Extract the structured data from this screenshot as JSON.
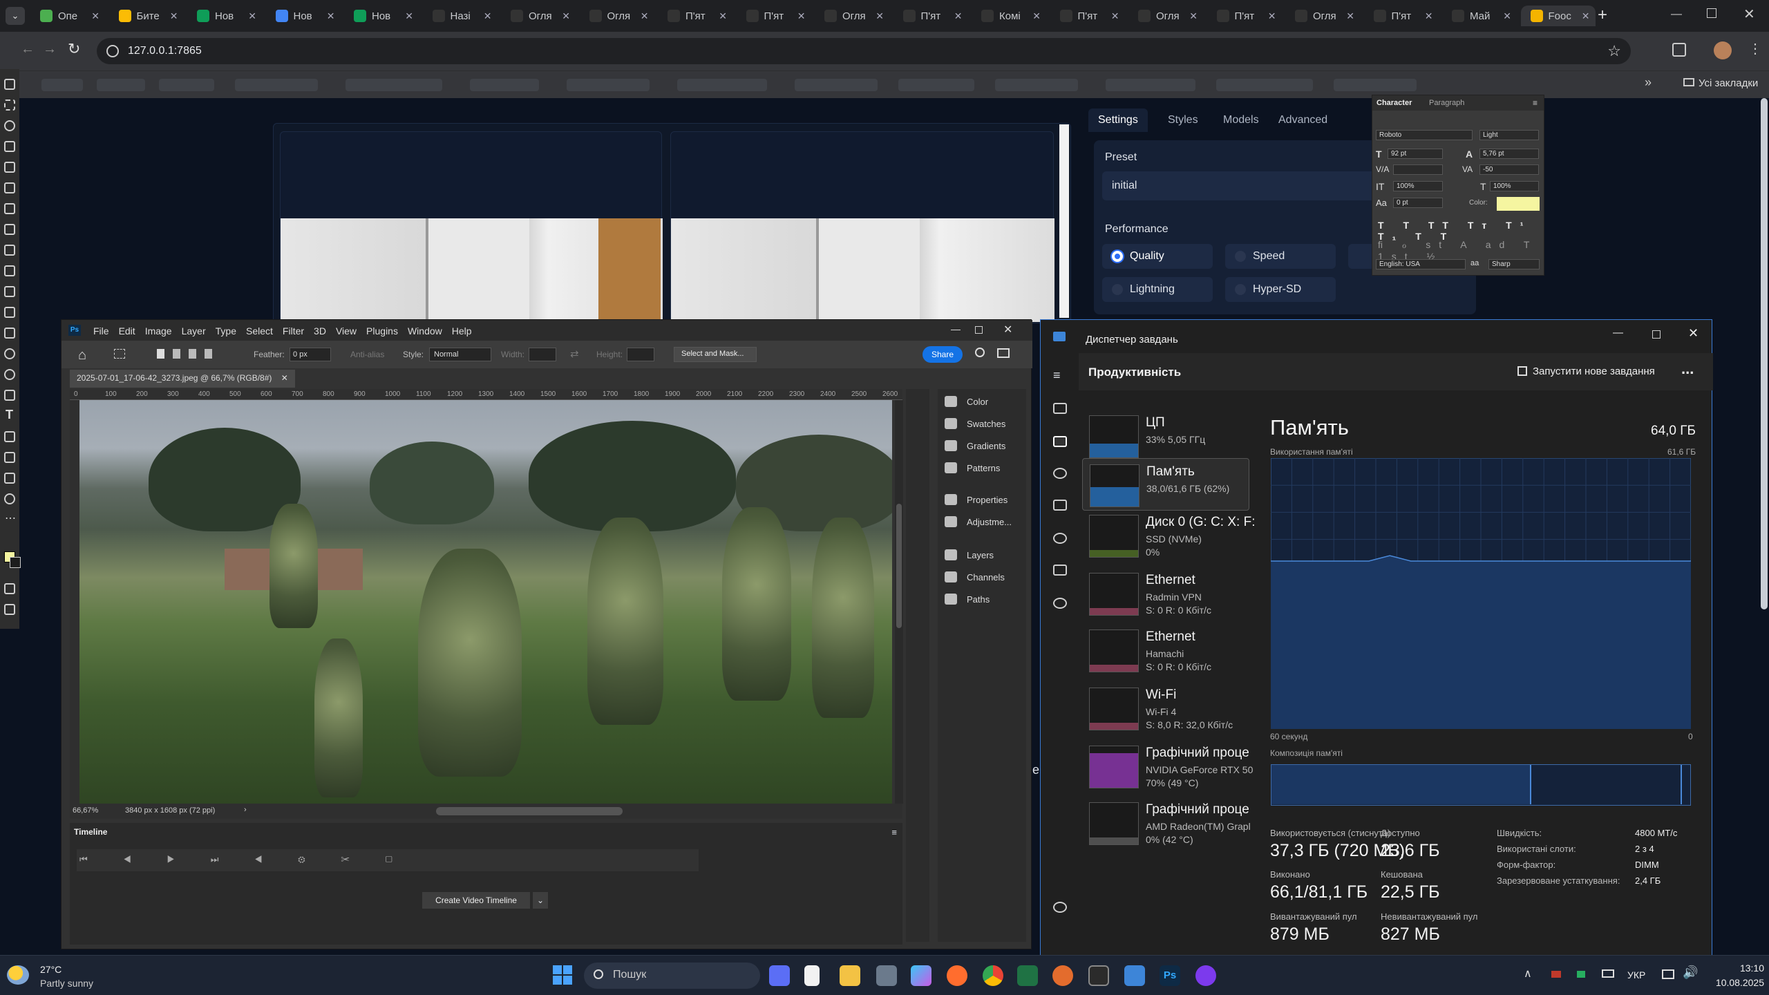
{
  "browser": {
    "tabs": [
      "Опе",
      "Бите",
      "Нов",
      "Нов",
      "Нов",
      "Назі",
      "Огля",
      "Огля",
      "П'ят",
      "П'ят",
      "Огля",
      "П'ят",
      "Комі",
      "П'ят",
      "Огля",
      "П'ят",
      "Огля",
      "П'ят",
      "Май",
      "Fooc"
    ],
    "address": "127.0.0.1:7865",
    "all_bookmarks": "Усі закладки"
  },
  "settings_panel": {
    "tabs": [
      "Settings",
      "Styles",
      "Models",
      "Advanced"
    ],
    "preset_label": "Preset",
    "preset_value": "initial",
    "performance_label": "Performance",
    "options": [
      "Quality",
      "Speed",
      "Lightning",
      "Hyper-SD"
    ],
    "selected": "Quality",
    "stray_char": "e"
  },
  "character_palette": {
    "tabs": [
      "Character",
      "Paragraph"
    ],
    "font": "Roboto",
    "style": "Light",
    "size": "92 pt",
    "leading": "5,76 pt",
    "tracking": "-50",
    "vscale": "100%",
    "hscale": "100%",
    "baseline": "0 pt",
    "color_label": "Color:",
    "color": "#f5f5a0",
    "language": "English: USA",
    "aa_label": "aa",
    "antialias": "Sharp"
  },
  "photoshop": {
    "logo": "Ps",
    "menu": [
      "File",
      "Edit",
      "Image",
      "Layer",
      "Type",
      "Select",
      "Filter",
      "3D",
      "View",
      "Plugins",
      "Window",
      "Help"
    ],
    "feather_label": "Feather:",
    "feather_value": "0 px",
    "antialias": "Anti-alias",
    "style_label": "Style:",
    "style_value": "Normal",
    "width_label": "Width:",
    "height_label": "Height:",
    "select_mask": "Select and Mask...",
    "share": "Share",
    "doc_tab": "2025-07-01_17-06-42_3273.jpeg @ 66,7% (RGB/8#)",
    "ruler": [
      "0",
      "100",
      "200",
      "300",
      "400",
      "500",
      "600",
      "700",
      "800",
      "900",
      "1000",
      "1100",
      "1200",
      "1300",
      "1400",
      "1500",
      "1600",
      "1700",
      "1800",
      "1900",
      "2000",
      "2100",
      "2200",
      "2300",
      "2400",
      "2500",
      "2600"
    ],
    "zoom": "66,67%",
    "doc_size": "3840 px x 1608 px (72 ppi)",
    "timeline_label": "Timeline",
    "create_timeline": "Create Video Timeline",
    "panels": [
      "Color",
      "Swatches",
      "Gradients",
      "Patterns",
      "Properties",
      "Adjustme...",
      "Layers",
      "Channels",
      "Paths"
    ],
    "fg_color": "#f5f5a0"
  },
  "task_manager": {
    "title": "Диспетчер завдань",
    "section": "Продуктивність",
    "new_task": "Запустити нове завдання",
    "more": "...",
    "items": [
      {
        "title": "ЦП",
        "l2": "33%  5,05 ГГц",
        "l3": ""
      },
      {
        "title": "Пам'ять",
        "l2": "38,0/61,6 ГБ (62%)",
        "l3": ""
      },
      {
        "title": "Диск 0 (G: C: X: F:",
        "l2": "SSD (NVMe)",
        "l3": "0%"
      },
      {
        "title": "Ethernet",
        "l2": "Radmin VPN",
        "l3": "S: 0 R: 0 Кбіт/с"
      },
      {
        "title": "Ethernet",
        "l2": "Hamachi",
        "l3": "S: 0 R: 0 Кбіт/с"
      },
      {
        "title": "Wi-Fi",
        "l2": "Wi-Fi 4",
        "l3": "S: 8,0 R: 32,0 Кбіт/с"
      },
      {
        "title": "Графічний проце",
        "l2": "NVIDIA GeForce RTX 50",
        "l3": "70% (49 °C)"
      },
      {
        "title": "Графічний проце",
        "l2": "AMD Radeon(TM) Grapl",
        "l3": "0% (42 °C)"
      }
    ],
    "memory_title": "Пам'ять",
    "memory_total": "64,0 ГБ",
    "usage_label": "Використання пам'яті",
    "usage_max": "61,6 ГБ",
    "time_left": "60 секунд",
    "time_right": "0",
    "composition_label": "Композиція пам'яті",
    "usage_fraction": 0.62,
    "stats": {
      "in_use_label": "Використовується (стиснута)",
      "in_use": "37,3 ГБ (720 МБ)",
      "available_label": "Доступно",
      "available": "23,6 ГБ",
      "committed_label": "Виконано",
      "committed": "66,1/81,1 ГБ",
      "cached_label": "Кешована",
      "cached": "22,5 ГБ",
      "paged_label": "Вивантажуваний пул",
      "paged": "879 МБ",
      "nonpaged_label": "Невивантажуваний пул",
      "nonpaged": "827 МБ"
    },
    "specs": [
      {
        "k": "Швидкість:",
        "v": "4800 МТ/с"
      },
      {
        "k": "Використані слоти:",
        "v": "2 з 4"
      },
      {
        "k": "Форм-фактор:",
        "v": "DIMM"
      },
      {
        "k": "Зарезервоване устаткування:",
        "v": "2,4 ГБ"
      }
    ]
  },
  "taskbar": {
    "temp": "27°C",
    "weather": "Partly sunny",
    "search": "Пошук",
    "lang": "УКР",
    "time": "13:10",
    "date": "10.08.2025",
    "ps_icon": "Ps"
  }
}
